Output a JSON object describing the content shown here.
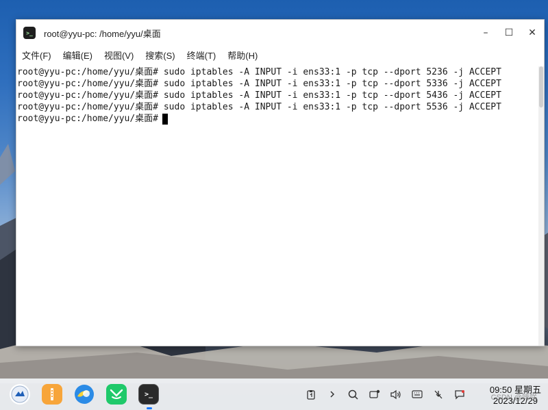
{
  "window": {
    "title": "root@yyu-pc: /home/yyu/桌面",
    "minimize": "–",
    "maximize": "☐",
    "close": "✕"
  },
  "menu": [
    "文件(F)",
    "编辑(E)",
    "视图(V)",
    "搜索(S)",
    "终端(T)",
    "帮助(H)"
  ],
  "terminal": {
    "lines": [
      "root@yyu-pc:/home/yyu/桌面# sudo iptables -A INPUT -i ens33:1 -p tcp --dport 5236 -j ACCEPT",
      "root@yyu-pc:/home/yyu/桌面# sudo iptables -A INPUT -i ens33:1 -p tcp --dport 5336 -j ACCEPT",
      "root@yyu-pc:/home/yyu/桌面# sudo iptables -A INPUT -i ens33:1 -p tcp --dport 5436 -j ACCEPT",
      "root@yyu-pc:/home/yyu/桌面# sudo iptables -A INPUT -i ens33:1 -p tcp --dport 5536 -j ACCEPT"
    ],
    "prompt": "root@yyu-pc:/home/yyu/桌面#"
  },
  "taskbar": {
    "apps": [
      "launcher-icon",
      "file-manager-icon",
      "browser-icon",
      "chat-icon",
      "terminal-icon"
    ],
    "time": "09:50 星期五",
    "date": "2023/12/29",
    "watermark": "CSDN @啡咲"
  },
  "colors": {
    "accent": "#1677ff"
  }
}
